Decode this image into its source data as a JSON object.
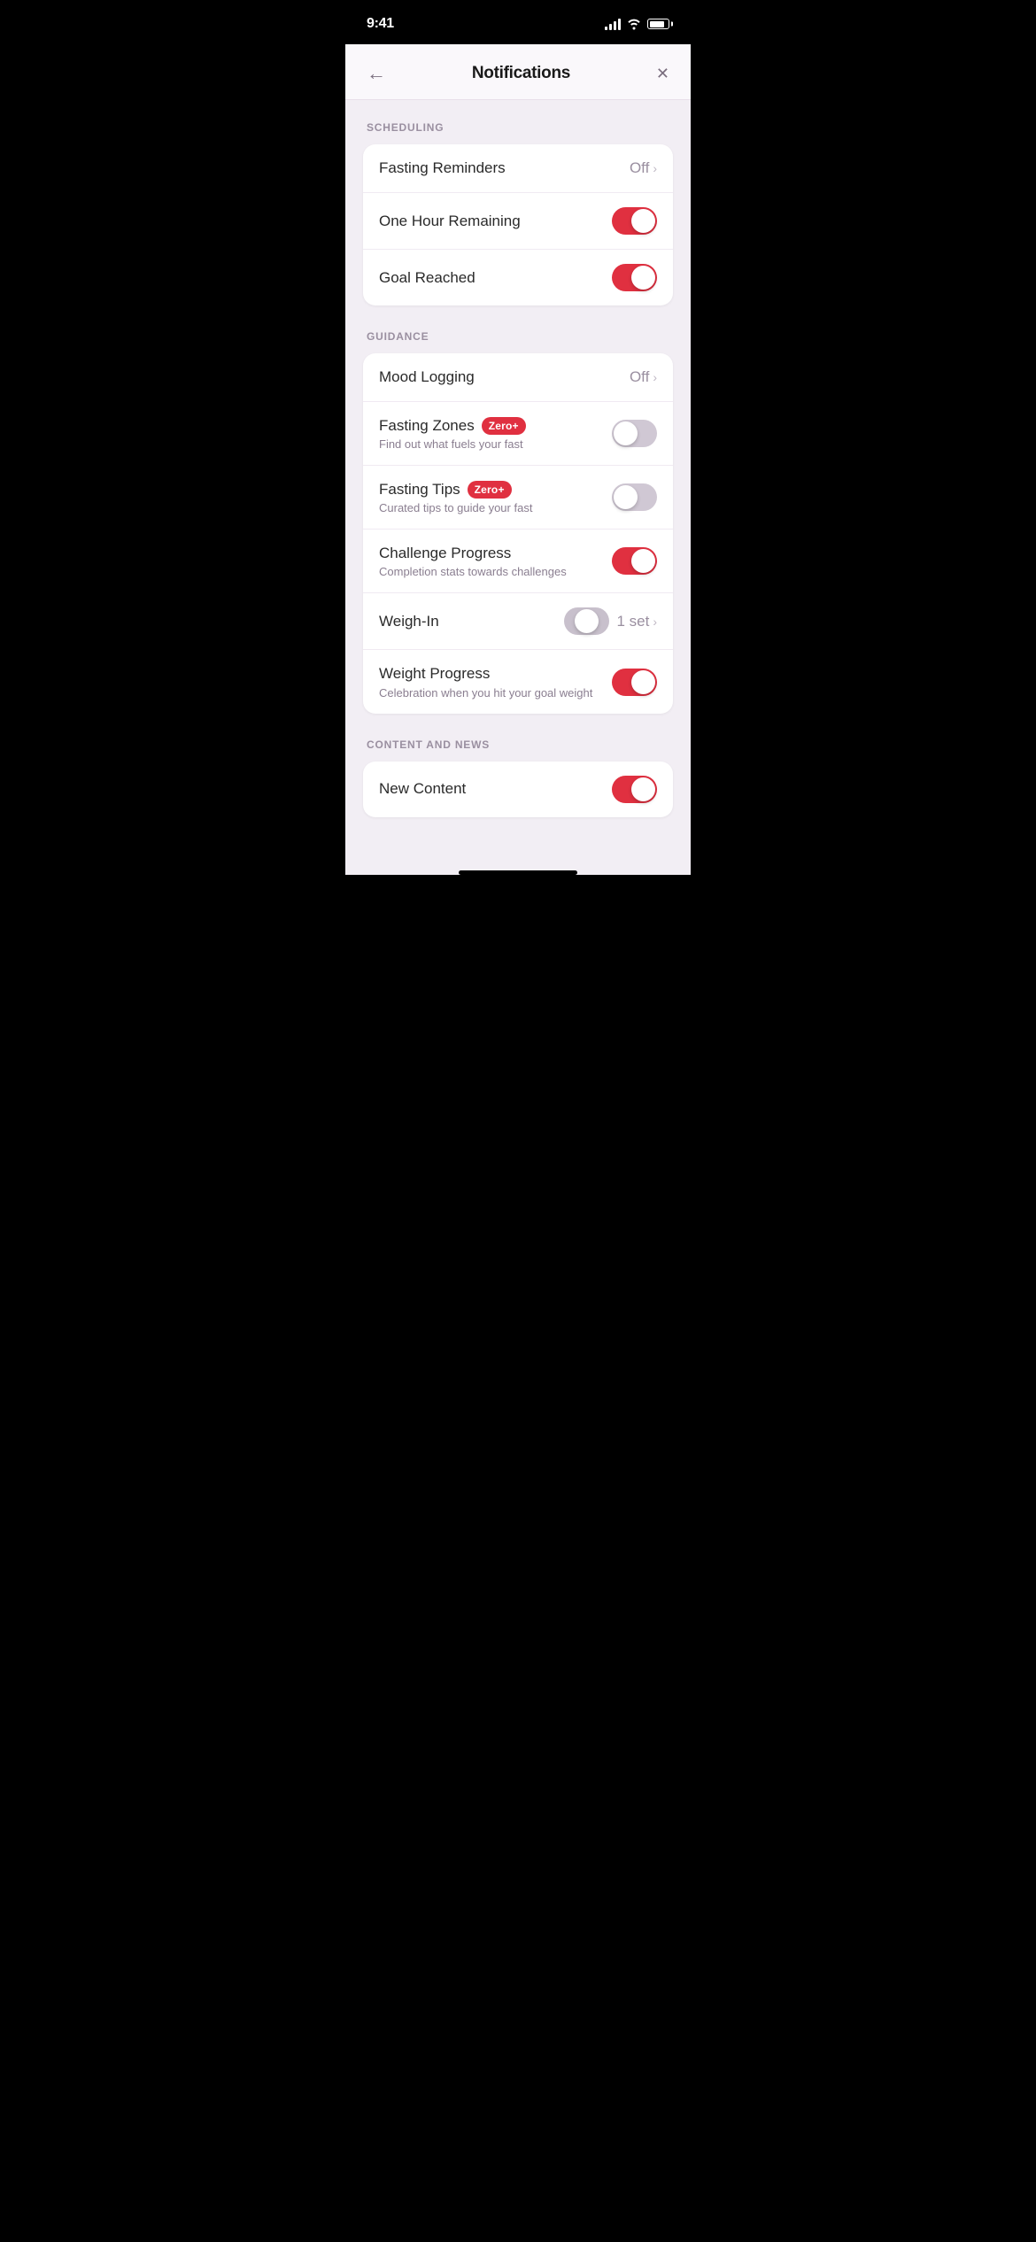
{
  "statusBar": {
    "time": "9:41",
    "battery_label": "Battery"
  },
  "header": {
    "title": "Notifications",
    "back_label": "←",
    "close_label": "✕"
  },
  "sections": {
    "scheduling": {
      "label": "SCHEDULING",
      "items": [
        {
          "id": "fasting-reminders",
          "title": "Fasting Reminders",
          "subtitle": "",
          "type": "chevron",
          "value": "Off",
          "state": "off"
        },
        {
          "id": "one-hour-remaining",
          "title": "One Hour Remaining",
          "subtitle": "",
          "type": "toggle",
          "state": "on"
        },
        {
          "id": "goal-reached",
          "title": "Goal Reached",
          "subtitle": "",
          "type": "toggle",
          "state": "on"
        }
      ]
    },
    "guidance": {
      "label": "GUIDANCE",
      "items": [
        {
          "id": "mood-logging",
          "title": "Mood Logging",
          "subtitle": "",
          "type": "chevron",
          "value": "Off",
          "state": "off"
        },
        {
          "id": "fasting-zones",
          "title": "Fasting Zones",
          "subtitle": "Find out what fuels your fast",
          "type": "toggle",
          "badge": "Zero+",
          "state": "off"
        },
        {
          "id": "fasting-tips",
          "title": "Fasting Tips",
          "subtitle": "Curated tips to guide your fast",
          "type": "toggle",
          "badge": "Zero+",
          "state": "off"
        },
        {
          "id": "challenge-progress",
          "title": "Challenge Progress",
          "subtitle": "Completion stats towards challenges",
          "type": "toggle",
          "state": "on"
        },
        {
          "id": "weigh-in",
          "title": "Weigh-In",
          "subtitle": "",
          "type": "toggle-chevron",
          "value": "1 set",
          "state": "center"
        },
        {
          "id": "weight-progress",
          "title": "Weight Progress",
          "subtitle": "Celebration when you hit your goal weight",
          "type": "toggle",
          "state": "on"
        }
      ]
    },
    "content_news": {
      "label": "CONTENT AND NEWS",
      "items": [
        {
          "id": "new-content",
          "title": "New Content",
          "subtitle": "",
          "type": "toggle",
          "state": "on"
        }
      ]
    }
  }
}
